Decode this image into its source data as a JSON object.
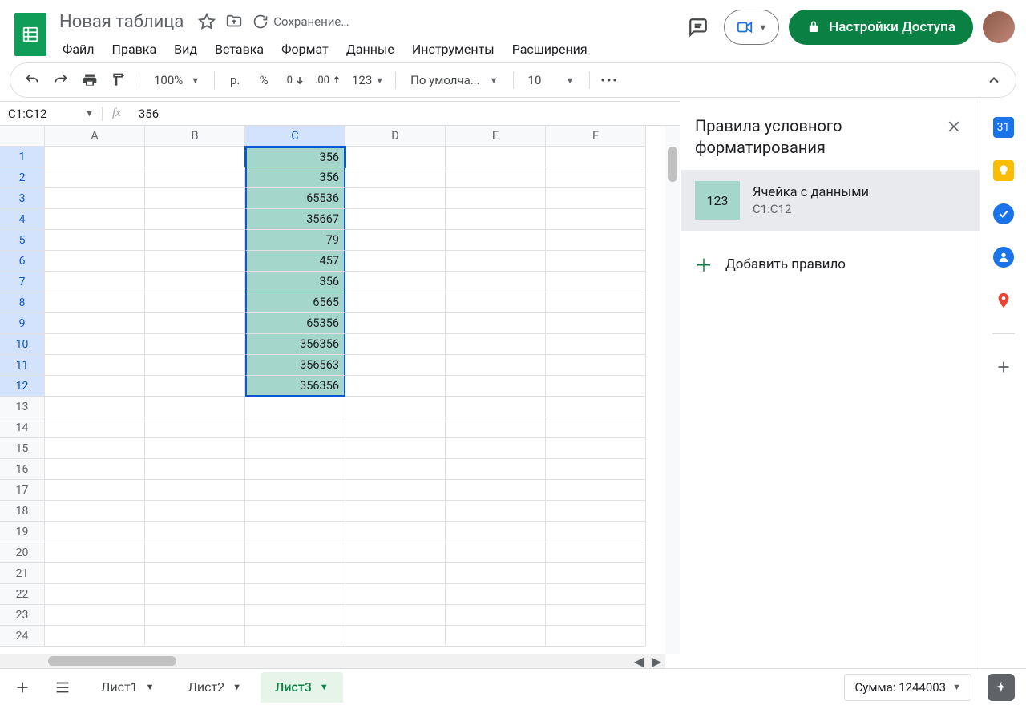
{
  "doc_title": "Новая таблица",
  "saving_label": "Сохранение…",
  "menus": [
    "Файл",
    "Правка",
    "Вид",
    "Вставка",
    "Формат",
    "Данные",
    "Инструменты",
    "Расширения"
  ],
  "share_label": "Настройки Доступа",
  "toolbar": {
    "zoom": "100%",
    "currency": "р.",
    "percent": "%",
    "dec_dec": ".0",
    "dec_inc": ".00",
    "num_fmt": "123",
    "font": "По умолча...",
    "font_size": "10"
  },
  "name_box": "C1:C12",
  "fx_value": "356",
  "columns": [
    "A",
    "B",
    "C",
    "D",
    "E",
    "F"
  ],
  "row_count": 24,
  "c_values": [
    "356",
    "356",
    "65536",
    "35667",
    "79",
    "457",
    "356",
    "6565",
    "65356",
    "356356",
    "356563",
    "356356"
  ],
  "sidepanel": {
    "title": "Правила условного форматирования",
    "rule_preview": "123",
    "rule_title": "Ячейка с данными",
    "rule_range": "C1:C12",
    "add_label": "Добавить правило"
  },
  "tabs": [
    "Лист1",
    "Лист2",
    "Лист3"
  ],
  "active_tab": 2,
  "sum_label": "Сумма: 1244003"
}
